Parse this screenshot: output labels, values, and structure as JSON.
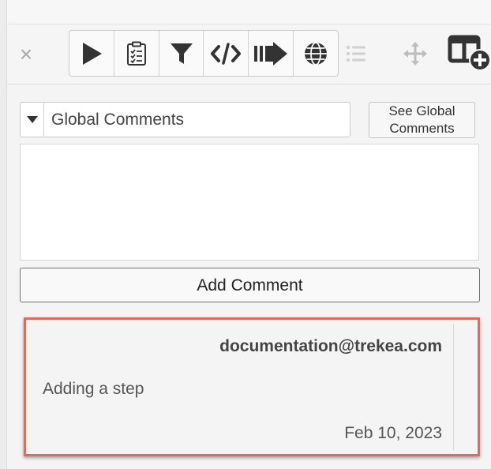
{
  "toolbar": {
    "close_glyph": "×",
    "buttons": [
      {
        "icon": "play-icon"
      },
      {
        "icon": "clipboard-checklist-icon"
      },
      {
        "icon": "filter-icon"
      },
      {
        "icon": "code-icon"
      },
      {
        "icon": "arrow-right-icon"
      },
      {
        "icon": "globe-icon"
      }
    ],
    "extra_icons": [
      "list-icon",
      "move-icon",
      "layout-add-icon"
    ]
  },
  "comments": {
    "scope_select": {
      "selected": "Global Comments"
    },
    "see_global_label": "See Global Comments",
    "input_value": "",
    "add_button_label": "Add Comment",
    "items": [
      {
        "author": "documentation@trekea.com",
        "text": "Adding a step",
        "date": "Feb 10, 2023"
      }
    ]
  },
  "colors": {
    "icon_dark": "#333333",
    "icon_light": "#b8b8b8",
    "highlight": "#e06b59"
  }
}
